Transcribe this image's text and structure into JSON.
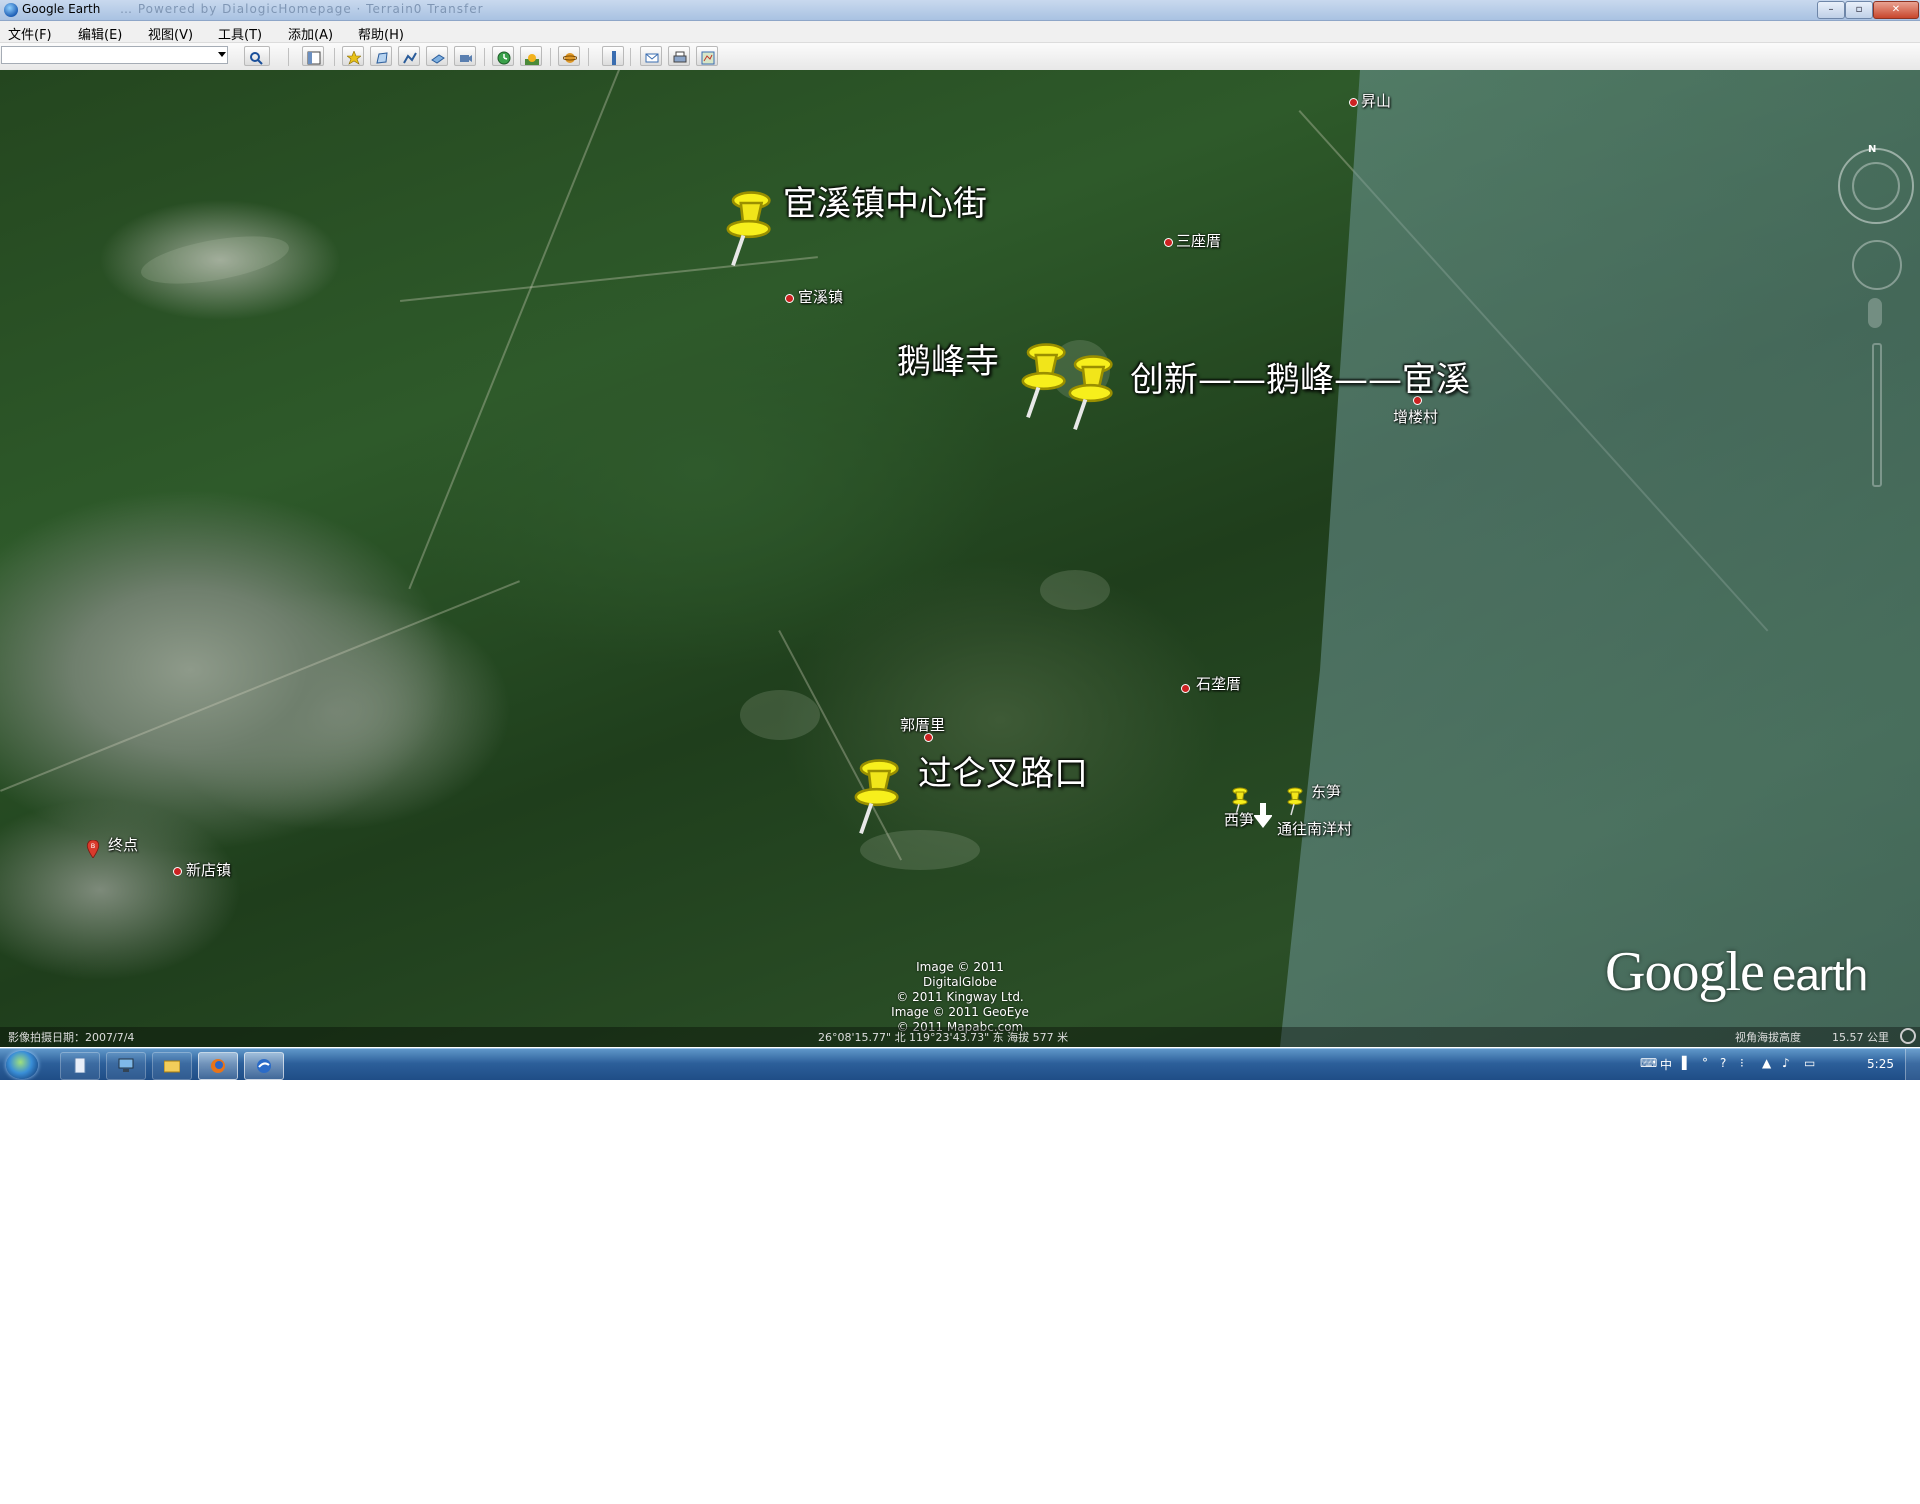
{
  "window": {
    "title": "Google Earth",
    "ghost_title": "… Powered by DialogicHomepage · Terrain0 Transfer",
    "buttons": {
      "minimize": "–",
      "restore": "▫",
      "close": "✕"
    }
  },
  "menu": {
    "items": [
      "文件(F)",
      "编辑(E)",
      "视图(V)",
      "工具(T)",
      "添加(A)",
      "帮助(H)"
    ]
  },
  "toolbar": {
    "search_value": "",
    "icons": [
      "search-icon",
      "sidebar-icon",
      "placemark-icon",
      "polygon-icon",
      "path-icon",
      "image-overlay-icon",
      "record-tour-icon",
      "historical-imagery-icon",
      "sun-icon",
      "planets-icon",
      "ruler-icon",
      "email-icon",
      "print-icon",
      "view-in-maps-icon"
    ]
  },
  "map": {
    "towns": [
      {
        "name": "昇山"
      },
      {
        "name": "三座厝"
      },
      {
        "name": "宦溪镇"
      },
      {
        "name": "增楼村"
      },
      {
        "name": "石垄厝"
      },
      {
        "name": "郭厝里"
      },
      {
        "name": "新店镇"
      },
      {
        "name": "东笋"
      },
      {
        "name": "西笋"
      },
      {
        "name": "通往南洋村"
      },
      {
        "name": "终点"
      }
    ],
    "pins": [
      {
        "label": "宦溪镇中心街"
      },
      {
        "label": "鹅峰寺"
      },
      {
        "label": "创新——鹅峰——宦溪"
      },
      {
        "label": "过仑叉路口"
      }
    ],
    "end_marker": "B",
    "credits": [
      "Image © 2011 DigitalGlobe",
      "© 2011 Kingway Ltd.",
      "Image © 2011 GeoEye",
      "© 2011 Mapabc.com"
    ],
    "logo_main": "Google",
    "logo_sub": "earth",
    "nav_north": "N"
  },
  "status": {
    "imagery_date": "影像拍摄日期：2007/7/4",
    "coords": "26°08'15.77\" 北 119°23'43.73\" 东 海拔  577 米",
    "eye_alt_label": "视角海拔高度",
    "eye_alt": "15.57 公里"
  },
  "taskbar": {
    "clock": "5:25",
    "ime": "中",
    "tasks": [
      "notepad",
      "computer",
      "explorer",
      "firefox",
      "google-earth"
    ]
  }
}
